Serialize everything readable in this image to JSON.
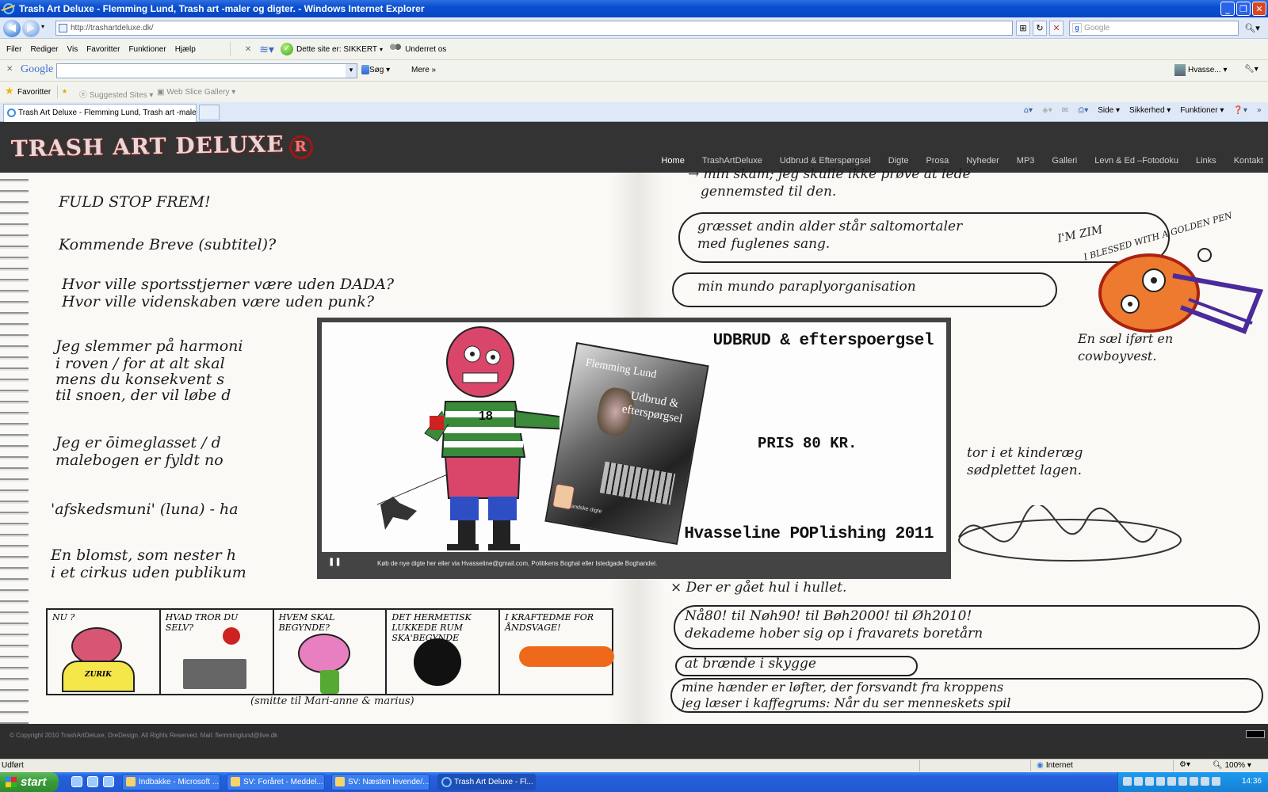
{
  "window": {
    "title": "Trash Art Deluxe - Flemming Lund, Trash art -maler og digter. - Windows Internet Explorer",
    "controls": [
      "_",
      "❐",
      "✕"
    ]
  },
  "address_bar": {
    "url": "http://trashartdeluxe.dk/",
    "search_placeholder": "Google"
  },
  "menu": {
    "items": [
      "Filer",
      "Rediger",
      "Vis",
      "Favoritter",
      "Funktioner",
      "Hjælp"
    ],
    "site_status": "Dette site er: SIKKERT",
    "notify": "Underret os"
  },
  "google_toolbar": {
    "logo": "Google",
    "search_btn": "Søg",
    "more_btn": "Mere »",
    "user": "Hvasse..."
  },
  "favorites_bar": {
    "favorites": "Favoritter",
    "suggested": "Suggested Sites",
    "web_slice": "Web Slice Gallery"
  },
  "tabs": [
    {
      "label": "Trash Art Deluxe - Flemming Lund, Trash art -maler o..."
    }
  ],
  "command_bar": {
    "page": "Side",
    "safety": "Sikkerhed",
    "tools": "Funktioner"
  },
  "site": {
    "logo": "TRASH ART DELUXE",
    "logo_mark": "R",
    "nav": [
      "Home",
      "TrashArtDeluxe",
      "Udbrud & Efterspørgsel",
      "Digte",
      "Prosa",
      "Nyheder",
      "MP3",
      "Galleri",
      "Levn & Ed –Fotodoku",
      "Links",
      "Kontakt"
    ],
    "active_nav": "Home",
    "footer": "© Copyright 2010 TrashArtDeluxe, DreDesign, All Rights Reserved.  Mail: flemminglund@live.dk"
  },
  "notebook": {
    "left": [
      "FULD STOP FREM!",
      "Kommende Breve (subtitel)?",
      "Hvor ville sportsstjerner være uden DADA?",
      "Hvor ville videnskaben være uden punk?",
      "Jeg slemmer på harmoni",
      "i roven / for at alt skal",
      "mens du konsekvent s",
      "til snoen, der vil løbe d",
      "Jeg er ōimeglasset / d",
      "malebogen er fyldt no",
      "'afskedsmuni' (luna) - ha",
      "En blomst, som nester h",
      "i et cirkus uden publikum"
    ],
    "right": [
      "→ min skam; jeg skulle ikke prøve at lede",
      "gennemsted til den.",
      "græsset andin alder står saltomortaler",
      "med fuglenes sang.",
      "min mundo paraplyorganisation",
      "En sæl iført en",
      "cowboyvest.",
      "I'M ZIM",
      "I BLESSED WITH A GOLDEN PEN",
      "tor i et kinderæg",
      "sødplettet lagen.",
      "× Der er gået hul i hullet.",
      "Nå80! til Nøh90! til Bøh2000! til Øh2010!",
      "dekademe hober sig op i fravarets boretårn",
      "at brænde i skygge",
      "mine hænder er løfter, der forsvandt fra kroppens",
      "jeg læser i kaffegrums: Når du ser menneskets spil"
    ],
    "comic": [
      {
        "text": "NU ?",
        "tag": "ZURIK"
      },
      {
        "text": "HVAD TROR DU SELV?"
      },
      {
        "text": "HVEM SKAL BEGYNDE?"
      },
      {
        "text": "DET HERMETISK LUKKEDE RUM SKA'BEGYNDE"
      },
      {
        "text": "I KRAFTEDME FOR ÅNDSVAGE!"
      }
    ],
    "comic_caption": "(smitte til Mari-anne & marius)"
  },
  "slideshow": {
    "headline": "UDBRUD & efterspoergsel",
    "price": "PRIS 80 KR.",
    "publisher": "Hvasseline POPlishing 2011",
    "book_author": "Flemming Lund",
    "book_title": "Udbrud & efterspørgsel",
    "book_sub": "udenlandske digte",
    "shirt_number": "18",
    "caption": "Køb de nye digte her eller via Hvasseline@gmail.com, Politikens Boghal eller Istedgade Boghandel.",
    "pause_symbol": "❚❚"
  },
  "statusbar": {
    "status": "Udført",
    "zone": "Internet",
    "zoom": "100%"
  },
  "taskbar": {
    "start": "start",
    "buttons": [
      "Indbakke - Microsoft ...",
      "SV: Foråret - Meddel...",
      "SV: Næsten levende/...",
      "Trash Art Deluxe - Fl..."
    ],
    "clock": "14:36"
  }
}
